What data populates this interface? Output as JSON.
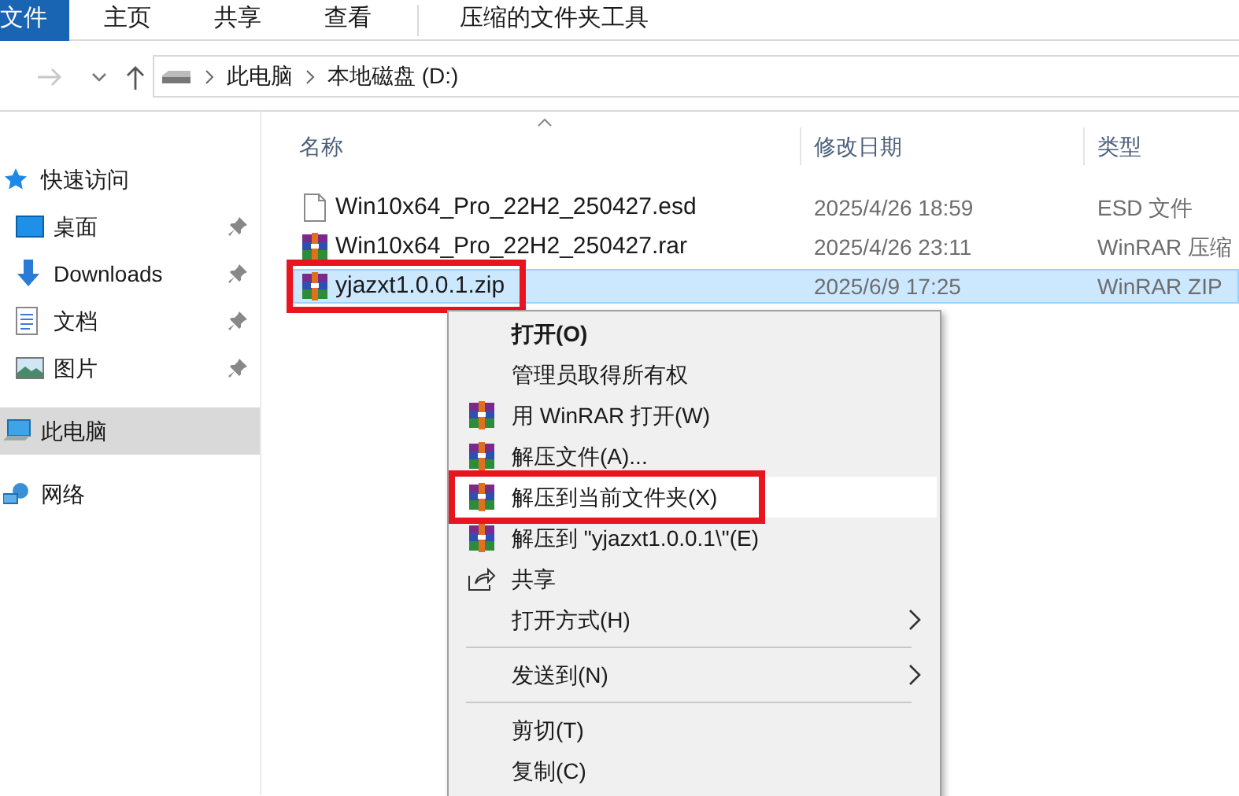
{
  "ribbon_tabs": [
    {
      "label": "文件",
      "selected": true
    },
    {
      "label": "主页",
      "selected": false
    },
    {
      "label": "共享",
      "selected": false
    },
    {
      "label": "查看",
      "selected": false
    },
    {
      "label": "压缩的文件夹工具",
      "selected": false
    }
  ],
  "breadcrumb": [
    "此电脑",
    "本地磁盘 (D:)"
  ],
  "sidebar": {
    "items": [
      {
        "kind": "star",
        "label": "快速访问",
        "pinned": false,
        "selected": false,
        "children": [
          {
            "kind": "desktop",
            "label": "桌面",
            "pinned": true,
            "selected": false
          },
          {
            "kind": "download",
            "label": "Downloads",
            "pinned": true,
            "selected": false
          },
          {
            "kind": "document",
            "label": "文档",
            "pinned": true,
            "selected": false
          },
          {
            "kind": "picture",
            "label": "图片",
            "pinned": true,
            "selected": false
          }
        ]
      },
      {
        "kind": "computer",
        "label": "此电脑",
        "pinned": false,
        "selected": true
      },
      {
        "kind": "network",
        "label": "网络",
        "pinned": false,
        "selected": false
      }
    ]
  },
  "table": {
    "columns": [
      "名称",
      "修改日期",
      "类型"
    ],
    "rows": [
      {
        "kind": "file",
        "name": "Win10x64_Pro_22H2_250427.esd",
        "date": "2025/4/26 18:59",
        "type": "ESD 文件",
        "selected": false,
        "highlighted": false
      },
      {
        "kind": "archive",
        "name": "Win10x64_Pro_22H2_250427.rar",
        "date": "2025/4/26 23:11",
        "type": "WinRAR 压缩",
        "selected": false,
        "highlighted": false
      },
      {
        "kind": "archive",
        "name": "yjazxt1.0.0.1.zip",
        "date": "2025/6/9 17:25",
        "type": "WinRAR ZIP",
        "selected": true,
        "highlighted": true
      }
    ]
  },
  "context_menu": {
    "items": [
      {
        "kind": "plain",
        "label": "打开(O)",
        "bold": true,
        "submenu": false,
        "selected": false,
        "highlighted": false
      },
      {
        "kind": "plain",
        "label": "管理员取得所有权",
        "bold": false,
        "submenu": false,
        "selected": false,
        "highlighted": false
      },
      {
        "kind": "winrar",
        "label": "用 WinRAR 打开(W)",
        "bold": false,
        "submenu": false,
        "selected": false,
        "highlighted": false
      },
      {
        "kind": "winrar",
        "label": "解压文件(A)...",
        "bold": false,
        "submenu": false,
        "selected": false,
        "highlighted": false
      },
      {
        "kind": "winrar",
        "label": "解压到当前文件夹(X)",
        "bold": false,
        "submenu": false,
        "selected": true,
        "highlighted": true
      },
      {
        "kind": "winrar",
        "label": "解压到 \"yjazxt1.0.0.1\\\"(E)",
        "bold": false,
        "submenu": false,
        "selected": false,
        "highlighted": false
      },
      {
        "kind": "share",
        "label": "共享",
        "bold": false,
        "submenu": false,
        "selected": false,
        "highlighted": false
      },
      {
        "kind": "plain",
        "label": "打开方式(H)",
        "bold": false,
        "submenu": true,
        "selected": false,
        "highlighted": false
      },
      {
        "kind": "separator"
      },
      {
        "kind": "plain",
        "label": "发送到(N)",
        "bold": false,
        "submenu": true,
        "selected": false,
        "highlighted": false
      },
      {
        "kind": "separator"
      },
      {
        "kind": "plain",
        "label": "剪切(T)",
        "bold": false,
        "submenu": false,
        "selected": false,
        "highlighted": false
      },
      {
        "kind": "plain",
        "label": "复制(C)",
        "bold": false,
        "submenu": false,
        "selected": false,
        "highlighted": false
      }
    ]
  }
}
